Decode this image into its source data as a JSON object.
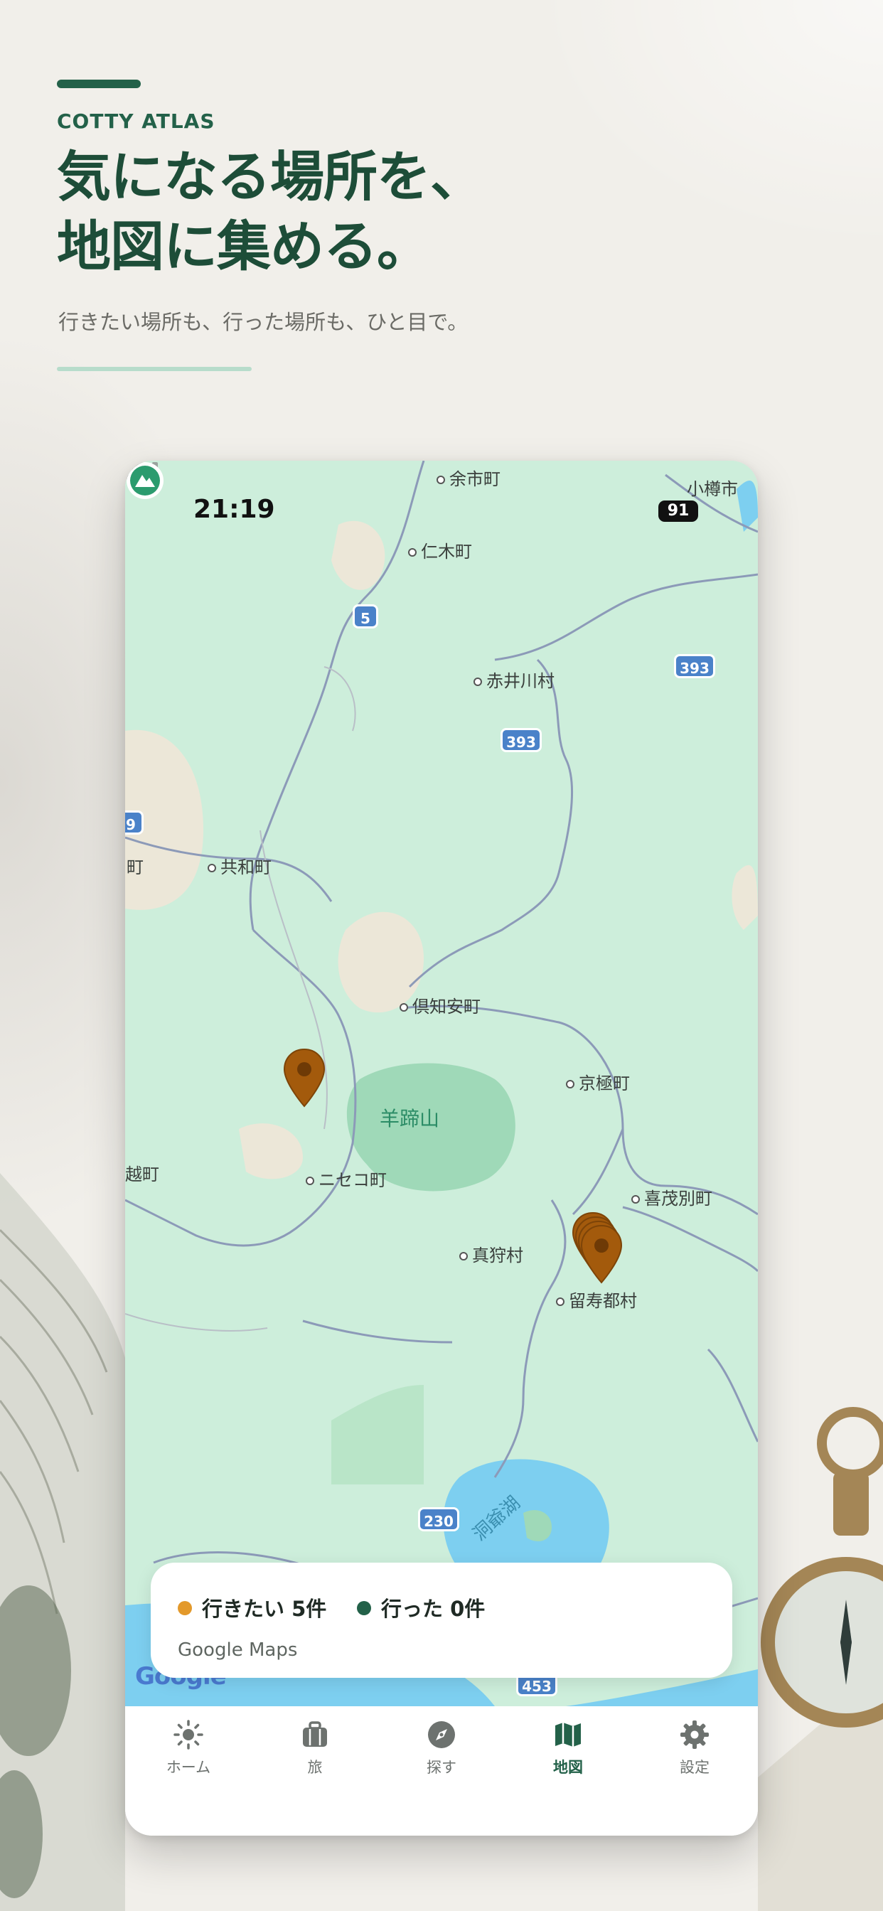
{
  "hero": {
    "eyebrow": "COTTY ATLAS",
    "headline_line1": "気になる場所を、",
    "headline_line2": "地図に集める。",
    "subtitle": "行きたい場所も、行った場所も、ひと目で。"
  },
  "status_bar": {
    "time": "21:19",
    "battery": "91"
  },
  "map": {
    "labels": {
      "yoichi": "余市町",
      "otaru": "小樽市",
      "niki": "仁木町",
      "akaigawa": "赤井川村",
      "kyowa": "共和町",
      "town_cut_left": "町",
      "kutchan": "倶知安町",
      "kyogoku": "京極町",
      "yoteizan": "羊蹄山",
      "rankoshi": "越町",
      "niseko": "ニセコ町",
      "kimobetsu": "喜茂別町",
      "makkari": "真狩村",
      "rusutsu": "留寿都村",
      "toyako": "洞爺湖"
    },
    "routes": {
      "r5": "5",
      "r393a": "393",
      "r393b": "393",
      "r9": "9",
      "r230": "230",
      "r453": "453"
    },
    "attribution": "Google",
    "pin_color": "#a35a0c"
  },
  "summary_card": {
    "want_label": "行きたい 5件",
    "want_color": "#e3992b",
    "visited_label": "行った 0件",
    "visited_color": "#236149",
    "source": "Google Maps"
  },
  "tabs": [
    {
      "label": "ホーム",
      "icon": "sun-icon"
    },
    {
      "label": "旅",
      "icon": "suitcase-icon"
    },
    {
      "label": "探す",
      "icon": "compass-icon"
    },
    {
      "label": "地図",
      "icon": "map-icon",
      "active": true
    },
    {
      "label": "設定",
      "icon": "gear-icon"
    }
  ],
  "colors": {
    "brand_green": "#236149",
    "map_land": "#cdeedb",
    "road": "#8c9ab8"
  }
}
